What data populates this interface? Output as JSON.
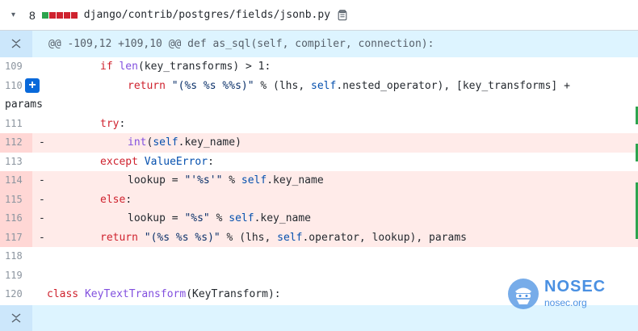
{
  "file": {
    "change_count": "8",
    "path": "django/contrib/postgres/fields/jsonb.py",
    "diffstat_colors": [
      "#2da44e",
      "#cf222e",
      "#cf222e",
      "#cf222e",
      "#cf222e"
    ]
  },
  "hunk": "@@ -109,12 +109,10 @@ def as_sql(self, compiler, connection):",
  "lines": [
    {
      "num": "109",
      "marker": "",
      "type": "ctx"
    },
    {
      "num": "110",
      "marker": "",
      "type": "ctx"
    },
    {
      "num": "111",
      "marker": "",
      "type": "ctx"
    },
    {
      "num": "112",
      "marker": "-",
      "type": "del"
    },
    {
      "num": "113",
      "marker": "",
      "type": "ctx"
    },
    {
      "num": "114",
      "marker": "-",
      "type": "del"
    },
    {
      "num": "115",
      "marker": "-",
      "type": "del"
    },
    {
      "num": "116",
      "marker": "-",
      "type": "del"
    },
    {
      "num": "117",
      "marker": "-",
      "type": "del"
    },
    {
      "num": "118",
      "marker": "",
      "type": "ctx"
    },
    {
      "num": "119",
      "marker": "",
      "type": "ctx"
    },
    {
      "num": "120",
      "marker": "",
      "type": "ctx"
    }
  ],
  "code": {
    "l109": [
      "if ",
      "len",
      "(key_transforms) > 1:"
    ],
    "l110": [
      "return ",
      "\"(%s %s %%s)\"",
      " % (lhs, ",
      "self",
      ".nested_operator), [key_transforms] +"
    ],
    "l110_wrap": "params",
    "l111": [
      "try",
      ":"
    ],
    "l112": [
      "int",
      "(",
      "self",
      ".key_name)"
    ],
    "l113": [
      "except ",
      "ValueError",
      ":"
    ],
    "l114": [
      "lookup = ",
      "\"'%s'\"",
      " % ",
      "self",
      ".key_name"
    ],
    "l115": [
      "else",
      ":"
    ],
    "l116": [
      "lookup = ",
      "\"%s\"",
      " % ",
      "self",
      ".key_name"
    ],
    "l117": [
      "return ",
      "\"(%s %s %s)\"",
      " % (lhs, ",
      "self",
      ".operator, lookup), params"
    ],
    "l120": [
      "class ",
      "KeyTextTransform",
      "(KeyTransform):"
    ]
  },
  "watermark": {
    "title": "NOSEC",
    "sub": "nosec.org"
  }
}
